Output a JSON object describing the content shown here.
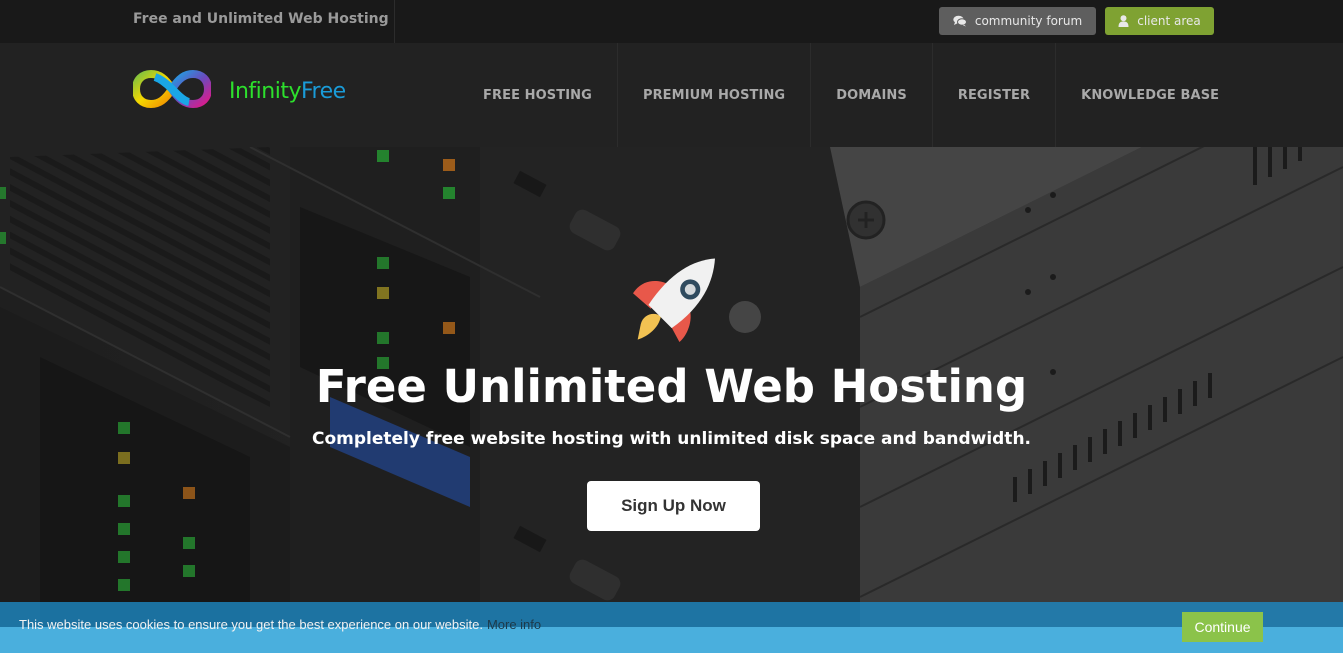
{
  "topbar": {
    "tagline": "Free and Unlimited Web Hosting",
    "community_forum_label": "community forum",
    "community_forum_icon": "comments-icon",
    "client_area_label": "client area",
    "client_area_icon": "user-icon",
    "community_forum_color": "#5e5e5e",
    "client_area_color": "#7fa232"
  },
  "brand": {
    "name_part1": "Infinity",
    "name_part2": "Free",
    "logo_icon": "infinity-logo-icon",
    "color_part1": "#2de02d",
    "color_part2": "#1a9bd7"
  },
  "nav": {
    "items": [
      {
        "label": "FREE HOSTING"
      },
      {
        "label": "PREMIUM HOSTING"
      },
      {
        "label": "DOMAINS"
      },
      {
        "label": "REGISTER"
      },
      {
        "label": "KNOWLEDGE BASE"
      }
    ]
  },
  "hero": {
    "icon": "rocket-icon",
    "title": "Free Unlimited Web Hosting",
    "subtitle": "Completely free website hosting with unlimited disk space and bandwidth.",
    "cta_label": "Sign Up Now",
    "background_image": "server-rack-illustration"
  },
  "cookie_banner": {
    "message": "This website uses cookies to ensure you get the best experience on our website.",
    "more_info_label": "More info",
    "continue_label": "Continue",
    "continue_color": "#8bc34a"
  }
}
